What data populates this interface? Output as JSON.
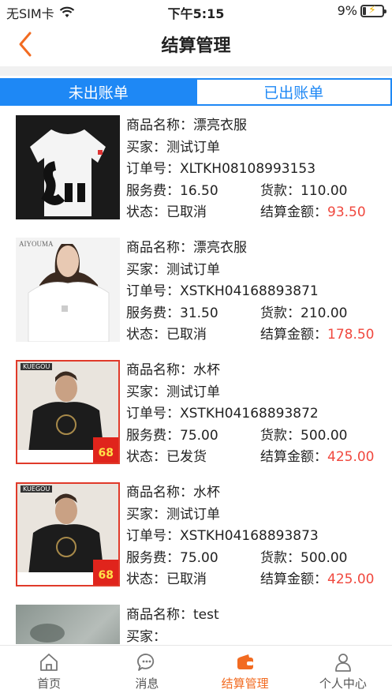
{
  "status_bar": {
    "carrier": "无SIM卡",
    "time": "下午5:15",
    "battery": "9%"
  },
  "header": {
    "title": "结算管理"
  },
  "tabs": [
    {
      "label": "未出账单",
      "active": true
    },
    {
      "label": "已出账单",
      "active": false
    }
  ],
  "labels": {
    "product_name": "商品名称：",
    "buyer": "买家：",
    "order_no": "订单号：",
    "service_fee": "服务费：",
    "goods_amount": "货款：",
    "status": "状态：",
    "settle_amount": "结算金额："
  },
  "items": [
    {
      "product_name": "漂亮衣服",
      "buyer": "测试订单",
      "order_no": "XLTKH08108993153",
      "service_fee": "16.50",
      "goods_amount": "110.00",
      "status": "已取消",
      "settle_amount": "93.50",
      "thumb": "white-sup-tshirt"
    },
    {
      "product_name": "漂亮衣服",
      "buyer": "测试订单",
      "order_no": "XSTKH04168893871",
      "service_fee": "31.50",
      "goods_amount": "210.00",
      "status": "已取消",
      "settle_amount": "178.50",
      "thumb_brand": "AIYOUMA",
      "thumb": "woman-white-tshirt"
    },
    {
      "product_name": "水杯",
      "buyer": "测试订单",
      "order_no": "XSTKH04168893872",
      "service_fee": "75.00",
      "goods_amount": "500.00",
      "status": "已发货",
      "settle_amount": "425.00",
      "thumb_brand": "KUEGOU",
      "thumb_price": "68",
      "thumb": "man-black-sweater"
    },
    {
      "product_name": "水杯",
      "buyer": "测试订单",
      "order_no": "XSTKH04168893873",
      "service_fee": "75.00",
      "goods_amount": "500.00",
      "status": "已取消",
      "settle_amount": "425.00",
      "thumb_brand": "KUEGOU",
      "thumb_price": "68",
      "thumb": "man-black-sweater"
    },
    {
      "product_name": "test",
      "thumb": "blurred-photo"
    }
  ],
  "tabbar": [
    {
      "label": "首页",
      "icon": "home-icon",
      "active": false
    },
    {
      "label": "消息",
      "icon": "message-icon",
      "active": false
    },
    {
      "label": "结算管理",
      "icon": "wallet-icon",
      "active": true
    },
    {
      "label": "个人中心",
      "icon": "user-icon",
      "active": false
    }
  ],
  "colors": {
    "accent": "#f26b21",
    "tab_blue": "#1e88f5",
    "amount_red": "#f0483e"
  }
}
